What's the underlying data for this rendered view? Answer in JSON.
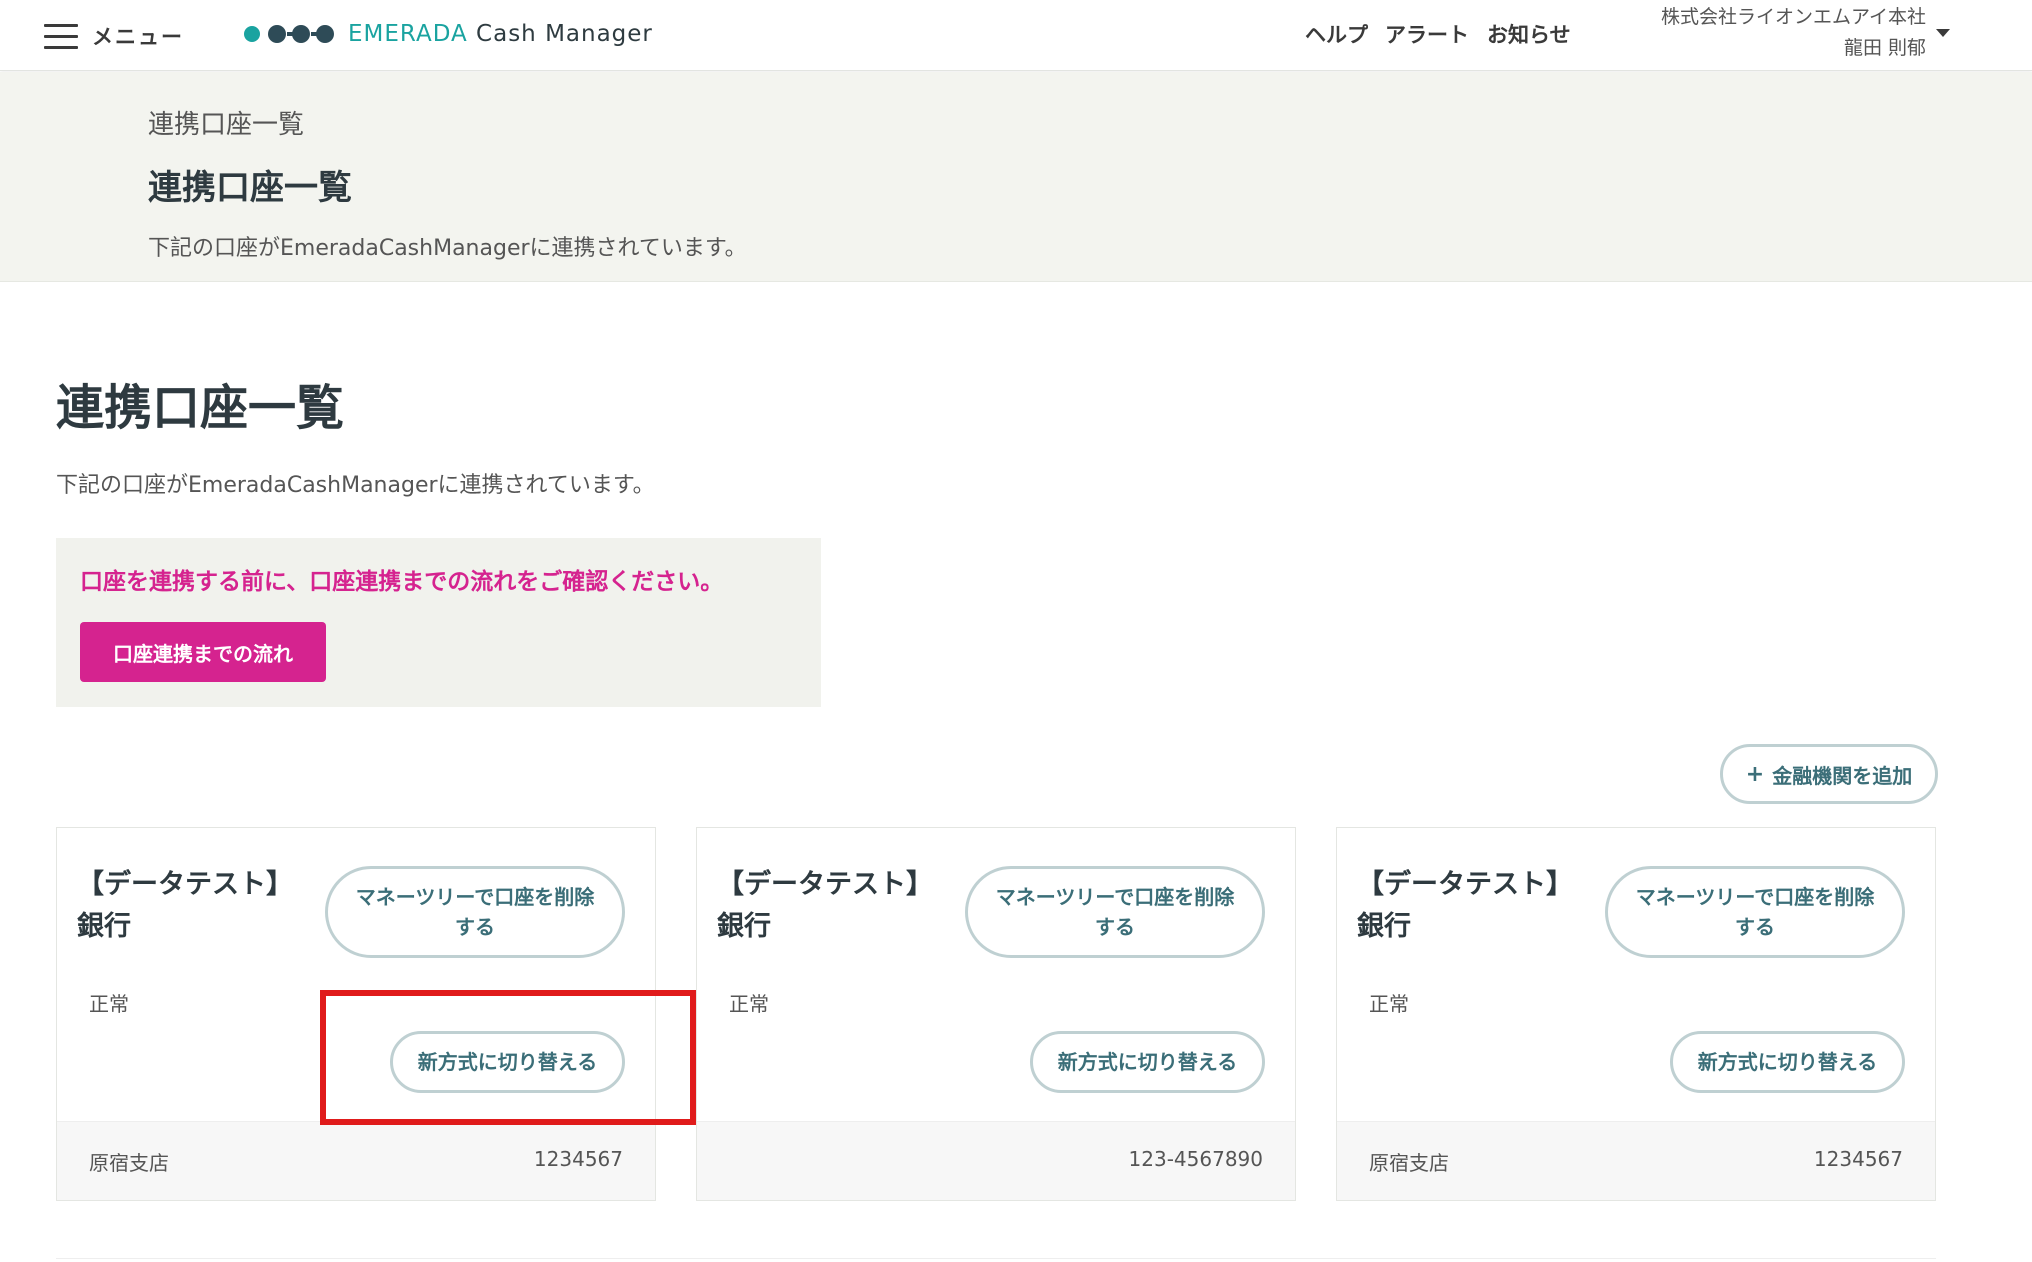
{
  "header": {
    "menu_label": "メニュー",
    "logo_emerada": "EMERADA",
    "logo_cash_manager": "Cash Manager",
    "nav": {
      "help": "ヘルプ",
      "alert": "アラート",
      "notice": "お知らせ"
    },
    "user": {
      "company": "株式会社ライオンエムアイ本社",
      "name": "龍田 則郁"
    }
  },
  "breadcrumb": {
    "small": "連携口座一覧",
    "title": "連携口座一覧",
    "desc": "下記の口座がEmeradaCashManagerに連携されています。"
  },
  "main": {
    "title": "連携口座一覧",
    "desc": "下記の口座がEmeradaCashManagerに連携されています。",
    "notice_text": "口座を連携する前に、口座連携までの流れをご確認ください。",
    "flow_button": "口座連携までの流れ",
    "add_button_icon": "+",
    "add_button": "金融機関を追加"
  },
  "cards": [
    {
      "bank_line1": "【データテスト】",
      "bank_line2": "銀行",
      "delete_button": "マネーツリーで口座を削除する",
      "status": "正常",
      "switch_button": "新方式に切り替える",
      "branch": "原宿支店",
      "account": "1234567"
    },
    {
      "bank_line1": "【データテスト】",
      "bank_line2": "銀行",
      "delete_button": "マネーツリーで口座を削除する",
      "status": "正常",
      "switch_button": "新方式に切り替える",
      "branch": "",
      "account": "123-4567890"
    },
    {
      "bank_line1": "【データテスト】",
      "bank_line2": "銀行",
      "delete_button": "マネーツリーで口座を削除する",
      "status": "正常",
      "switch_button": "新方式に切り替える",
      "branch": "原宿支店",
      "account": "1234567"
    }
  ],
  "colors": {
    "accent_teal": "#1aa3a0",
    "brand_magenta": "#d5238f",
    "pill_border": "#bfd0d2",
    "pill_text": "#3b6e78",
    "highlight_red": "#e01b1b"
  }
}
